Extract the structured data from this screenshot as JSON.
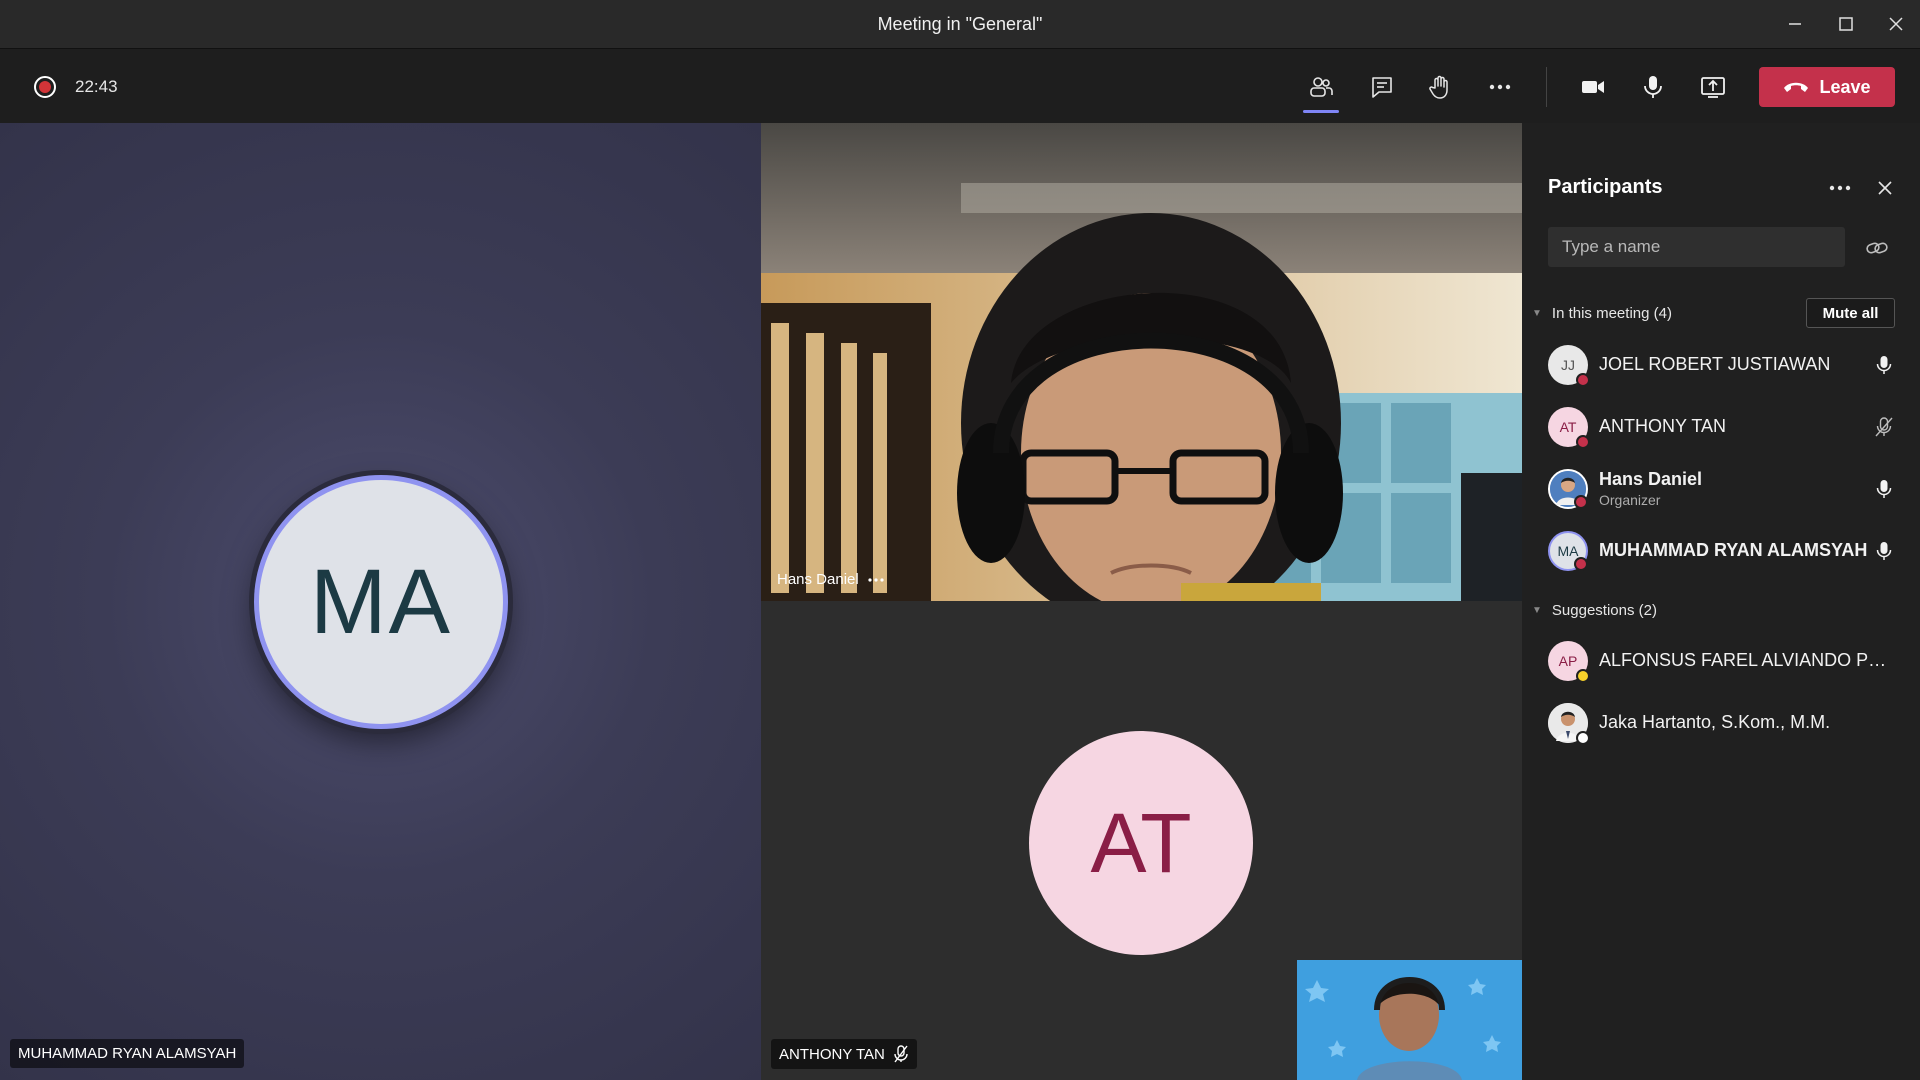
{
  "window": {
    "title": "Meeting in \"General\""
  },
  "toolbar": {
    "timer": "22:43",
    "leave_label": "Leave",
    "icons": [
      "participants-icon",
      "chat-icon",
      "raise-hand-icon",
      "more-icon",
      "camera-icon",
      "microphone-icon",
      "share-screen-icon",
      "hang-up-icon"
    ]
  },
  "stage": {
    "left_tile": {
      "initials": "MA",
      "name": "MUHAMMAD RYAN ALAMSYAH"
    },
    "video_tile": {
      "name": "Hans Daniel"
    },
    "at_tile": {
      "initials": "AT",
      "name": "ANTHONY TAN"
    }
  },
  "panel": {
    "title": "Participants",
    "search_placeholder": "Type a name",
    "in_meeting_label": "In this meeting (4)",
    "mute_all_label": "Mute all",
    "suggestions_label": "Suggestions (2)",
    "participants": [
      {
        "initials": "JJ",
        "name": "JOEL ROBERT JUSTIAWAN",
        "sub": "",
        "mic": "mic-on"
      },
      {
        "initials": "AT",
        "name": "ANTHONY TAN",
        "sub": "",
        "mic": "mic-off"
      },
      {
        "initials": "",
        "name": "Hans Daniel",
        "sub": "Organizer",
        "mic": "mic-on"
      },
      {
        "initials": "MA",
        "name": "MUHAMMAD RYAN ALAMSYAH",
        "sub": "",
        "mic": "mic-on"
      }
    ],
    "suggestions": [
      {
        "initials": "AP",
        "name": "ALFONSUS FAREL ALVIANDO PRATAMA"
      },
      {
        "initials": "",
        "name": "Jaka Hartanto, S.Kom., M.M."
      }
    ]
  },
  "colors": {
    "accent": "#7f85f5",
    "leave": "#c4314b",
    "status_busy": "#c4314b",
    "status_away": "#f8d22a"
  }
}
